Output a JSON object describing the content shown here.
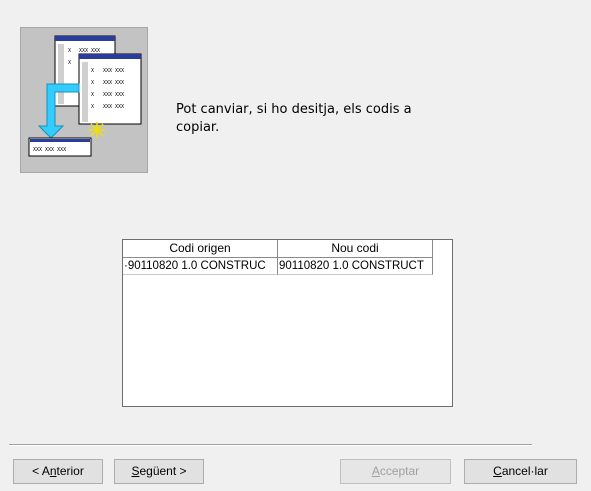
{
  "instruction": {
    "line1": "Pot canviar, si ho desitja, els codis a",
    "line2": "copiar."
  },
  "image": {
    "icon": "wizard-copy-codes-illustration",
    "labels": [
      "X",
      "XXX XXX",
      "XXX XXX XXX"
    ],
    "arrow_color": "#33ccff"
  },
  "grid": {
    "columns": [
      "Codi origen",
      "Nou codi"
    ],
    "rows": [
      [
        "·90110820 1.0 CONSTRUC",
        "90110820 1.0 CONSTRUCT"
      ]
    ]
  },
  "buttons": {
    "previous": {
      "pre": "< A",
      "accel": "n",
      "post": "terior"
    },
    "next": {
      "pre": "",
      "accel": "S",
      "post": "egüent >"
    },
    "accept": {
      "pre": "",
      "accel": "A",
      "post": "cceptar",
      "disabled": true
    },
    "cancel": {
      "pre": "",
      "accel": "C",
      "post": "ancel·lar"
    }
  }
}
